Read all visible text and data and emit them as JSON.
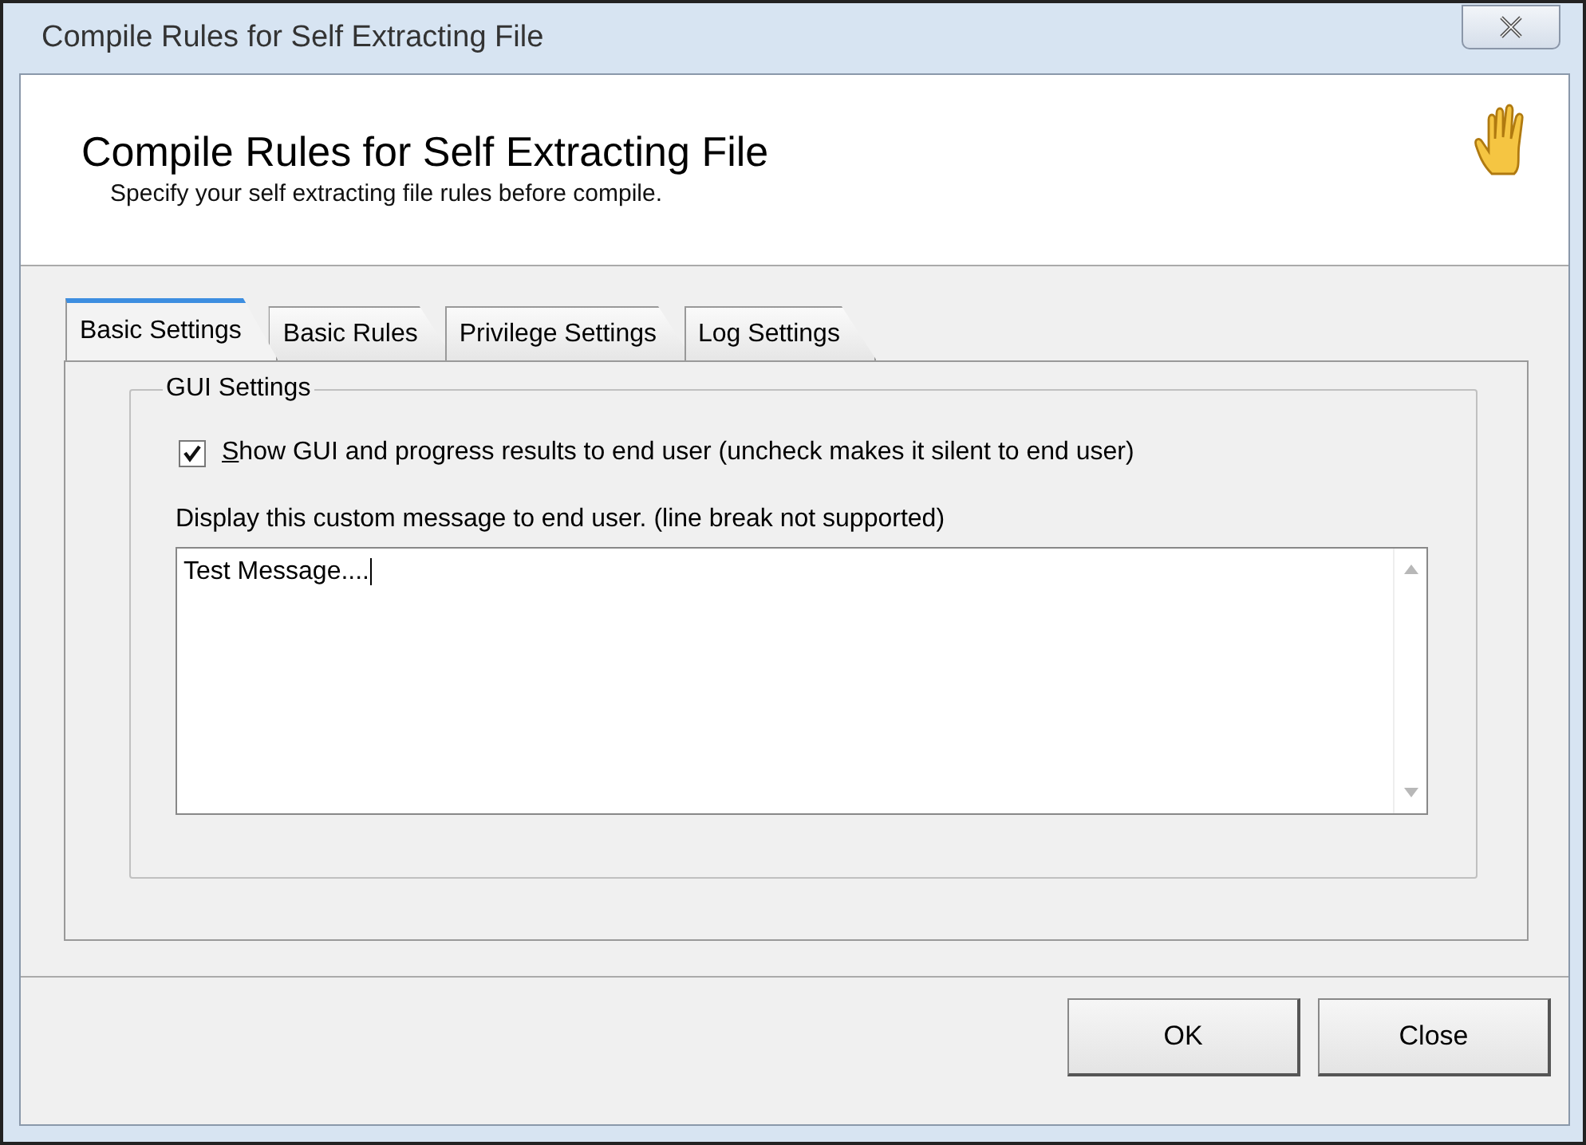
{
  "window": {
    "title": "Compile Rules for Self Extracting File"
  },
  "header": {
    "title": "Compile Rules for Self Extracting File",
    "subtitle": "Specify your self extracting file rules before compile."
  },
  "tabs": [
    {
      "label": "Basic Settings",
      "selected": true
    },
    {
      "label": "Basic Rules",
      "selected": false
    },
    {
      "label": "Privilege Settings",
      "selected": false
    },
    {
      "label": "Log Settings",
      "selected": false
    }
  ],
  "group": {
    "title": "GUI Settings",
    "checkbox": {
      "label": "Show GUI and progress results to end user (uncheck makes it silent to end user)",
      "checked": true
    },
    "message_label": "Display this custom message to end user. (line break not supported)",
    "message_value": "Test Message...."
  },
  "buttons": [
    "OK",
    "Close"
  ]
}
